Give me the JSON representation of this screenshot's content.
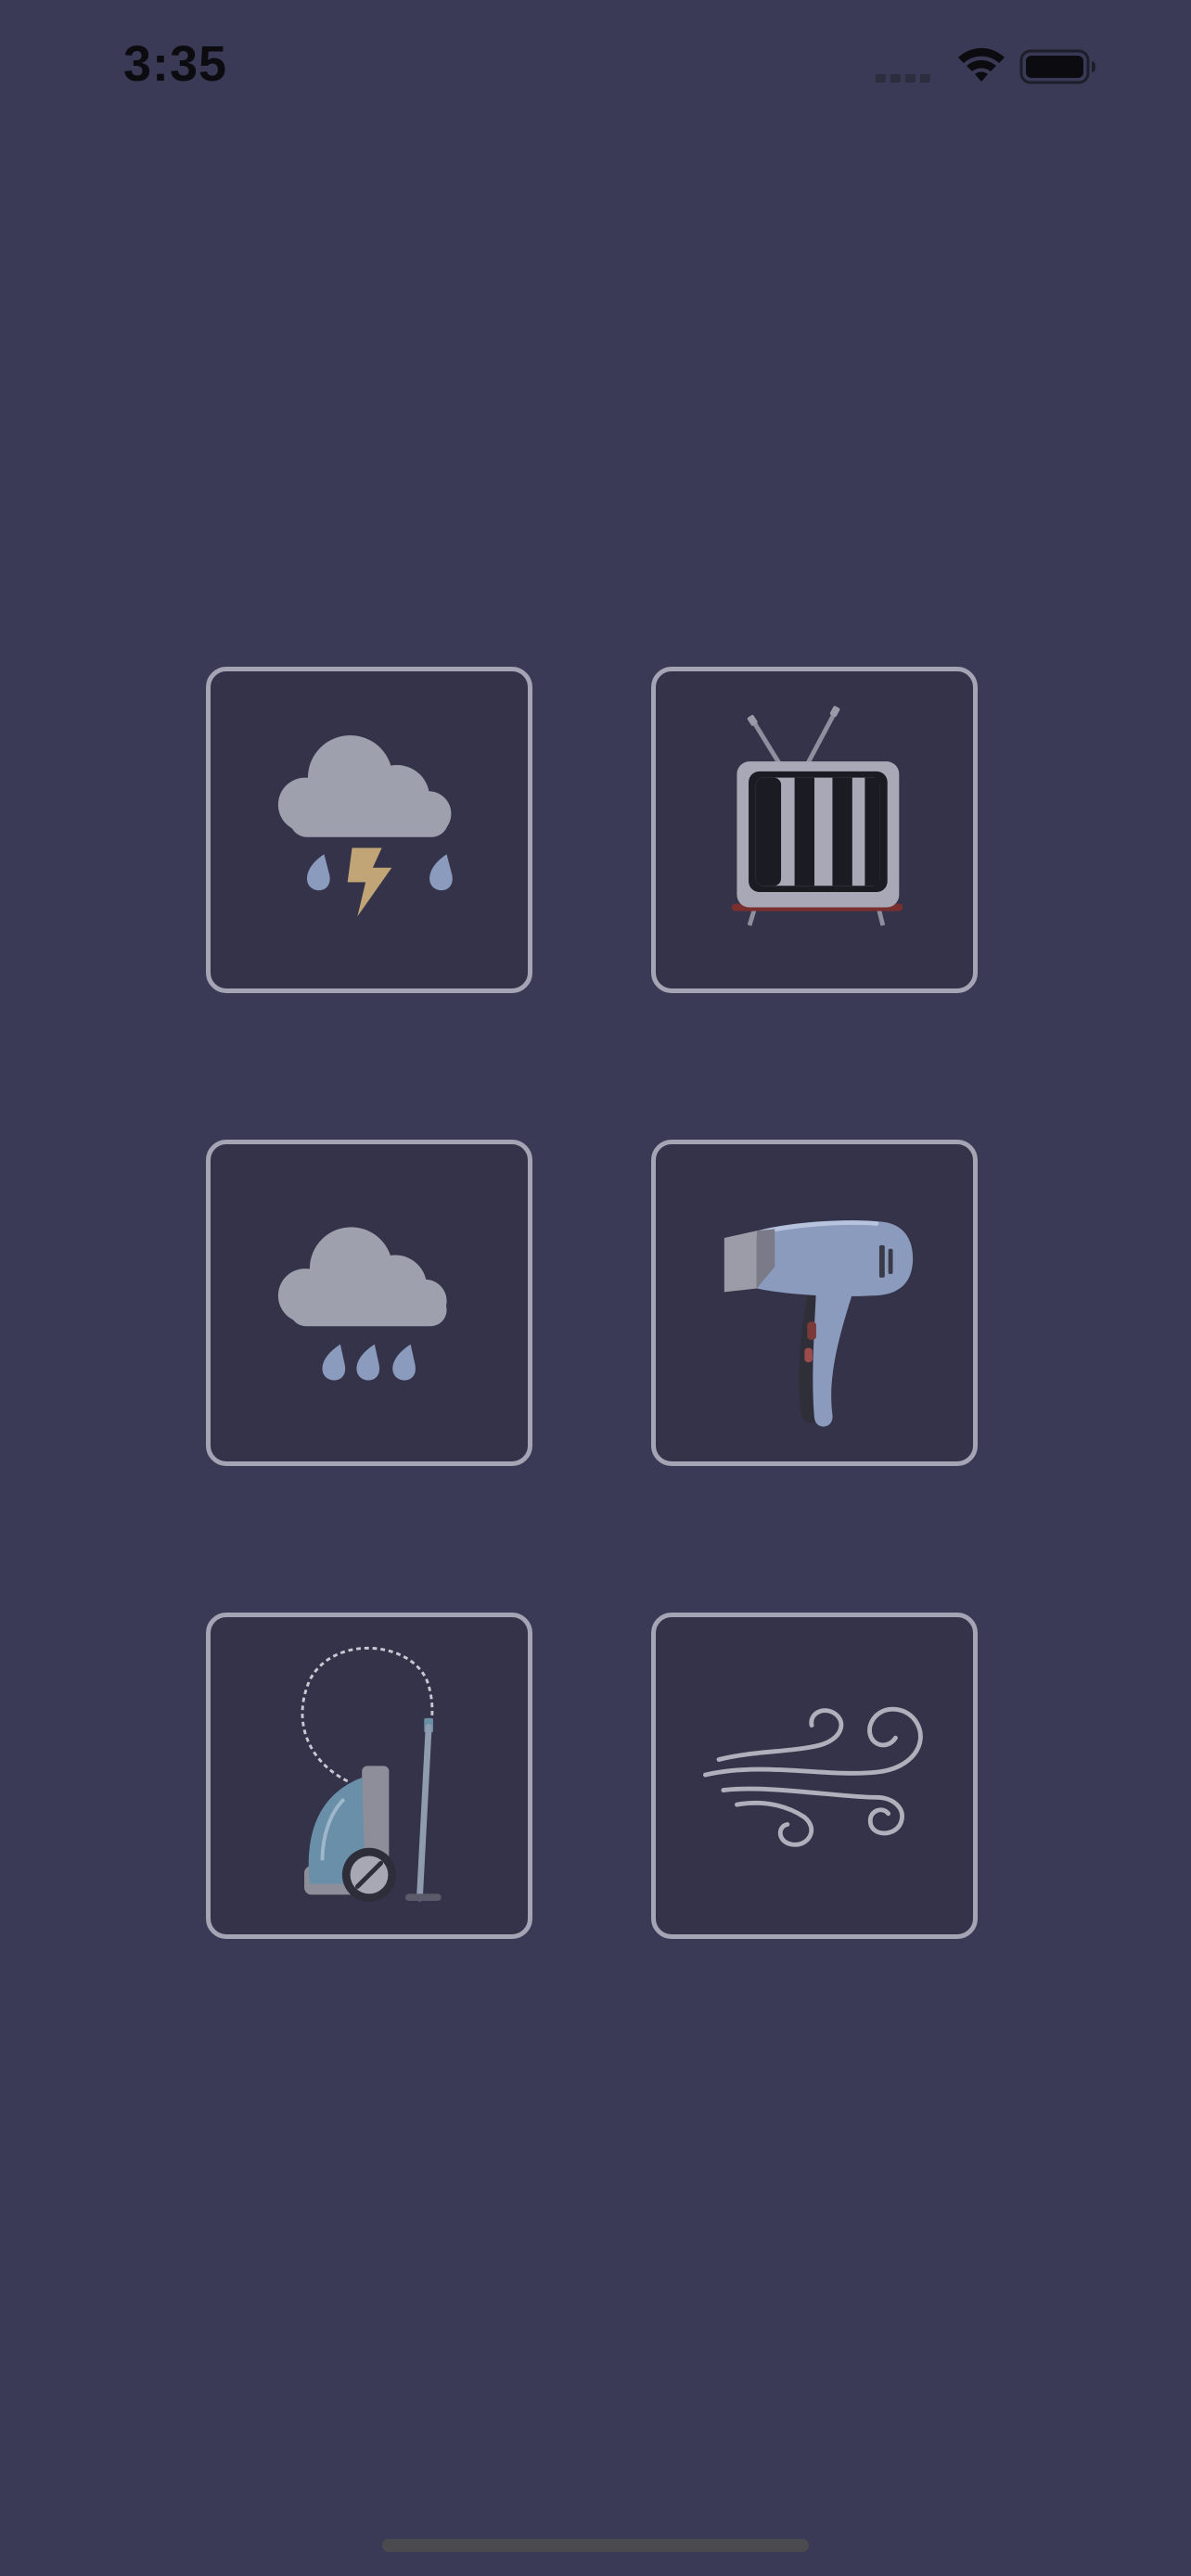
{
  "status_bar": {
    "time": "3:35",
    "icons": [
      "cellular-signal-icon",
      "wifi-icon",
      "battery-icon"
    ]
  },
  "tiles": [
    {
      "name": "thunderstorm-rain",
      "icon": "thunderstorm-icon"
    },
    {
      "name": "tv-static",
      "icon": "television-icon"
    },
    {
      "name": "rain",
      "icon": "rain-cloud-icon"
    },
    {
      "name": "hair-dryer",
      "icon": "hair-dryer-icon"
    },
    {
      "name": "vacuum-cleaner",
      "icon": "vacuum-cleaner-icon"
    },
    {
      "name": "wind",
      "icon": "wind-icon"
    }
  ],
  "colors": {
    "background": "#3a3a57",
    "tile_background": "#343349",
    "tile_border": "#a5a4b5",
    "cloud": "#9fa0ae",
    "raindrop": "#8b9bbd",
    "lightning": "#c2a577"
  }
}
